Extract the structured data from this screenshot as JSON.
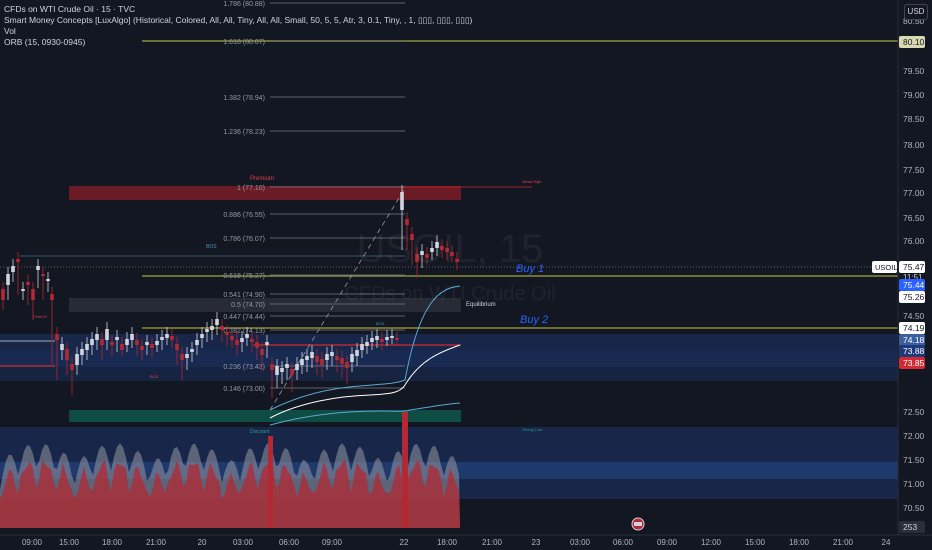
{
  "legend": {
    "symbol": "CFDs on WTI Crude Oil · 15 · TVC",
    "smc": "Smart Money Concepts [LuxAlgo] (Historical, Colored, All, All, Tiny, All, All, Small, 50, 5, 5, Atr, 3, 0.1, Tiny, , 1, ▯▯▯, ▯▯▯, ▯▯▯)",
    "vol": "Vol",
    "orb": "ORB (15, 0930-0945)"
  },
  "currency": "USD",
  "watermark": {
    "symbol": "USOIL, 15",
    "name": "CFDs on WTI Crude Oil"
  },
  "price_axis": {
    "ticks": [
      "80.50",
      "79.50",
      "79.00",
      "78.50",
      "78.00",
      "77.50",
      "77.00",
      "76.50",
      "76.00",
      "74.50",
      "72.50",
      "72.00",
      "71.50",
      "71.00",
      "70.50"
    ],
    "tags": {
      "top_level": "80.10",
      "symbol": "USOIL",
      "price": "75.47",
      "countdown": "11:51",
      "blue_level": "75.44",
      "level_a": "75.26",
      "level_b": "74.19",
      "level_c": "74.18",
      "level_d": "73.88",
      "level_e": "73.85",
      "volume": "253"
    }
  },
  "time_axis": [
    "09:00",
    "15:00",
    "18:00",
    "21:00",
    "20",
    "03:00",
    "06:00",
    "09:00",
    "22",
    "18:00",
    "21:00",
    "23",
    "03:00",
    "06:00",
    "09:00",
    "12:00",
    "15:00",
    "18:00",
    "21:00",
    "24"
  ],
  "fib": [
    {
      "label": "1.786 (80.88)"
    },
    {
      "label": "1.618 (80.07)"
    },
    {
      "label": "1.382 (78.94)"
    },
    {
      "label": "1.236 (78.23)"
    },
    {
      "label": "1 (77.10)"
    },
    {
      "label": "0.886 (76.55)"
    },
    {
      "label": "0.786 (76.07)"
    },
    {
      "label": "0.618 (75.27)"
    },
    {
      "label": "0.541 (74.90)"
    },
    {
      "label": "0.5 (74.70)"
    },
    {
      "label": "0.447 (74.44)"
    },
    {
      "label": "0.382 (74.13)"
    },
    {
      "label": "0.236 (73.43)"
    },
    {
      "label": "0.146 (73.00)"
    }
  ],
  "annotations": {
    "premium": "Premium",
    "weak_high": "Weak High",
    "equilibrium": "Equilibrium",
    "discount": "Discount",
    "strong_low": "Strong Low",
    "bos": "BOS",
    "choch": "CHoCH",
    "buy1": "Buy 1",
    "buy2": "Buy 2"
  },
  "colors": {
    "background": "#131722",
    "up": "#d1d4dc",
    "down": "#b22833",
    "accent_blue": "#2962ff",
    "olive": "#8c8c3a",
    "premium_zone": "#8a1e28",
    "demand_zone": "#1e3a7a",
    "discount_zone": "#0e5a4e"
  },
  "icons": {
    "replay": "replay-icon"
  }
}
